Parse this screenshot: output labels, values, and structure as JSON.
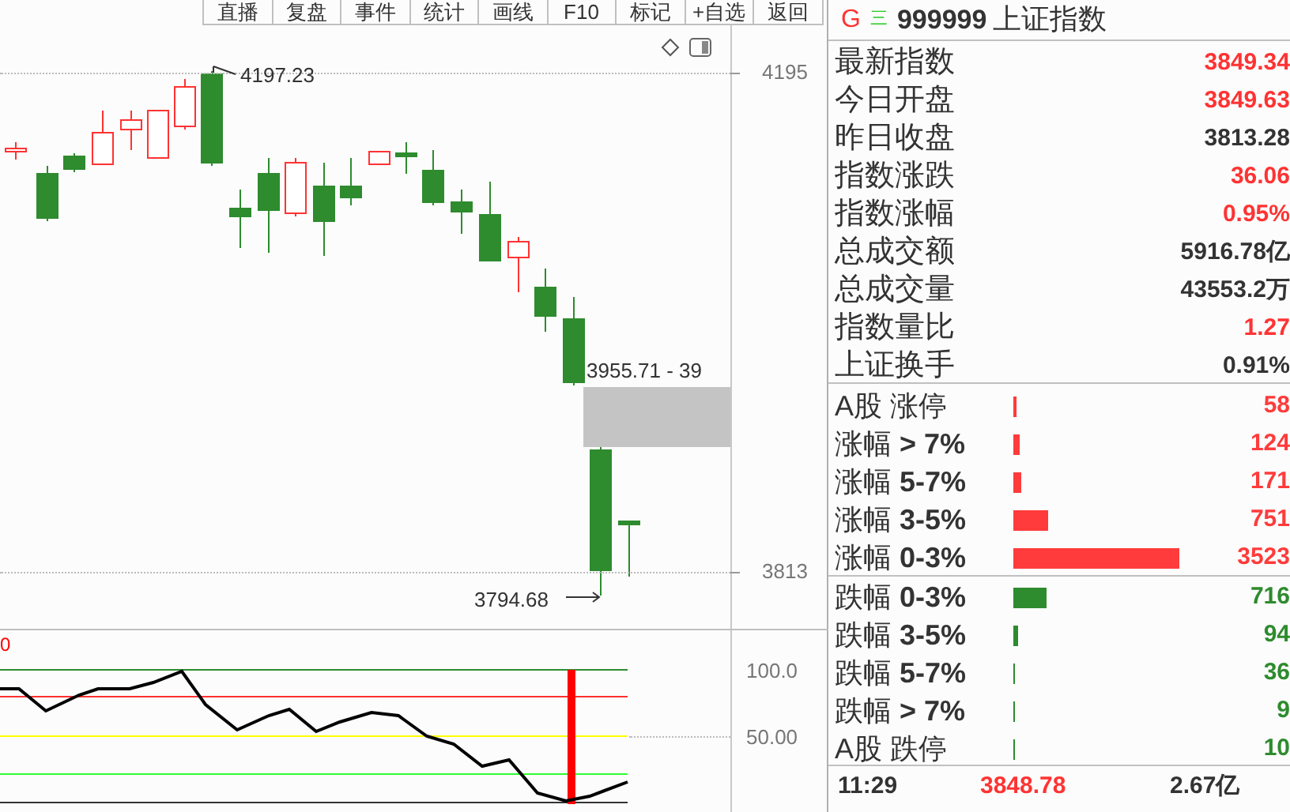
{
  "toolbar": [
    {
      "label": "直播"
    },
    {
      "label": "复盘"
    },
    {
      "label": "事件"
    },
    {
      "label": "统计"
    },
    {
      "label": "画线"
    },
    {
      "label": "F10"
    },
    {
      "label": "标记"
    },
    {
      "label": "+自选"
    },
    {
      "label": "返回"
    }
  ],
  "chart": {
    "high_label": "4197.23",
    "range_label": "3955.71 - 39",
    "low_label": "3794.68",
    "price_ticks": [
      "4195",
      "3813"
    ],
    "indicator_label": "0",
    "indicator_ticks": [
      "100.0",
      "50.00"
    ]
  },
  "quote_panel": {
    "market_tag": "G",
    "menu_glyph": "三",
    "code": "999999",
    "name": "上证指数",
    "rows": [
      {
        "label": "最新指数",
        "value": "3849.34",
        "color": "#ff3333"
      },
      {
        "label": "今日开盘",
        "value": "3849.63",
        "color": "#ff3333"
      },
      {
        "label": "昨日收盘",
        "value": "3813.28",
        "color": "#333333"
      },
      {
        "label": "指数涨跌",
        "value": "36.06",
        "color": "#ff3333"
      },
      {
        "label": "指数涨幅",
        "value": "0.95%",
        "color": "#ff3333"
      },
      {
        "label": "总成交额",
        "value": "5916.78亿",
        "color": "#333333"
      },
      {
        "label": "总成交量",
        "value": "43553.2万",
        "color": "#333333"
      },
      {
        "label": "指数量比",
        "value": "1.27",
        "color": "#ff3333"
      },
      {
        "label": "上证换手",
        "value": "0.91%",
        "color": "#333333"
      }
    ]
  },
  "breadth_up": [
    {
      "label": "A股 涨停",
      "count": "58",
      "color": "#ff3b3b"
    },
    {
      "label": "涨幅 **> 7%**",
      "count": "124",
      "color": "#ff3b3b"
    },
    {
      "label": "涨幅 **5-7%**",
      "count": "171",
      "color": "#ff3b3b"
    },
    {
      "label": "涨幅 **3-5%**",
      "count": "751",
      "color": "#ff3b3b"
    },
    {
      "label": "涨幅 **0-3%**",
      "count": "3523",
      "color": "#ff3b3b"
    }
  ],
  "breadth_down": [
    {
      "label": "跌幅 **0-3%**",
      "count": "716",
      "color": "#2e8b2e"
    },
    {
      "label": "跌幅 **3-5%**",
      "count": "94",
      "color": "#2e8b2e"
    },
    {
      "label": "跌幅 **5-7%**",
      "count": "36",
      "color": "#2e8b2e"
    },
    {
      "label": "跌幅 **> 7%**",
      "count": "9",
      "color": "#2e8b2e"
    },
    {
      "label": "A股 跌停",
      "count": "10",
      "color": "#2e8b2e"
    }
  ],
  "footer": {
    "time": "11:29",
    "price": "3848.78",
    "amount": "2.67亿"
  }
}
